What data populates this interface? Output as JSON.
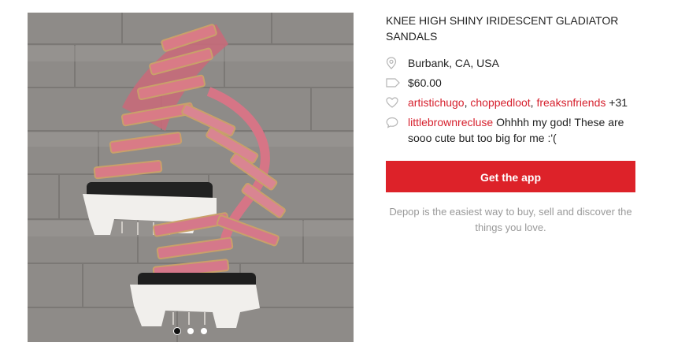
{
  "product": {
    "title": "KNEE HIGH SHINY IRIDESCENT GLADIATOR SANDALS",
    "location": "Burbank, CA, USA",
    "price": "$60.00",
    "likes": {
      "users": [
        "artistichugo",
        "choppedloot",
        "freaksnfriends"
      ],
      "more": "+31"
    },
    "comment": {
      "user": "littlebrownrecluse",
      "text": "Ohhhh my god! These are sooo cute but too big for me :'("
    },
    "image": {
      "alt": "Knee high iridescent gladiator sandals on wood floor",
      "slides": 3,
      "active_slide": 1
    }
  },
  "cta": {
    "button_label": "Get the app",
    "tagline": "Depop is the easiest way to buy, sell and discover the things you love."
  },
  "icons": {
    "location": "location-pin-icon",
    "price": "price-tag-icon",
    "likes": "heart-icon",
    "comment": "comment-bubble-icon"
  },
  "colors": {
    "accent": "#dd2229",
    "link": "#d6202d",
    "muted": "#999999"
  }
}
